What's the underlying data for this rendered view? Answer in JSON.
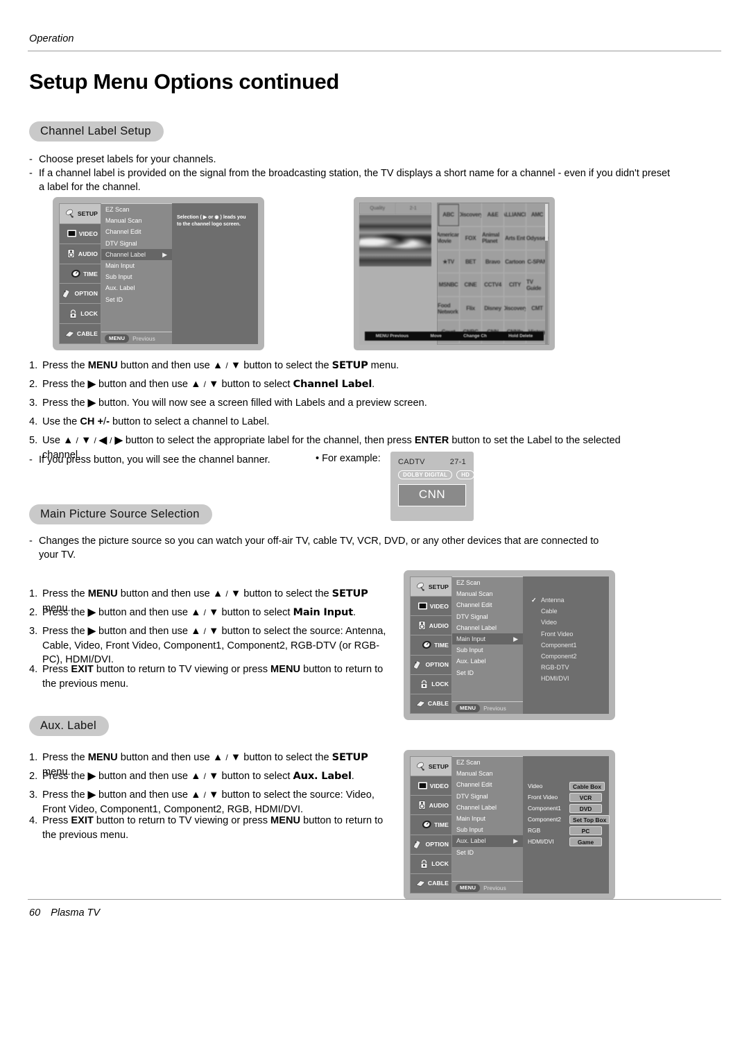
{
  "header": {
    "running_head": "Operation",
    "title": "Setup Menu Options continued"
  },
  "footer": {
    "page_number": "60",
    "product": "Plasma TV"
  },
  "sections": [
    {
      "id": "channel-label-setup",
      "heading": "Channel Label Setup",
      "bullets": [
        "Choose preset labels for your channels.",
        "If a channel label is provided on the signal from the broadcasting station, the TV displays a short name for a channel - even if you didn't preset a label for the channel."
      ],
      "steps": [
        {
          "num": "1.",
          "text": "Press the MENU button and then use ▲ / ▼ button to select the SETUP menu."
        },
        {
          "num": "2.",
          "text": "Press the ▶ button and then use ▲ / ▼ button to select Channel Label."
        },
        {
          "num": "3.",
          "text": "Press the ▶ button. You will now see a screen filled with Labels and a preview screen."
        },
        {
          "num": "4.",
          "text": "Use the CH +/- button to select a channel to Label."
        },
        {
          "num": "5.",
          "text": "Use ▲ / ▼ / ◀ / ▶ button to select the appropriate label for the channel, then press ENTER button to set the Label to the selected channel."
        }
      ],
      "note": "If you press          button, you will see the channel banner.",
      "example_label": "• For example:"
    },
    {
      "id": "main-picture-source-selection",
      "heading": "Main Picture Source Selection",
      "bullets": [
        "Changes the picture source so you can watch your off-air TV, cable TV, VCR, DVD, or any other devices that are connected to your TV."
      ],
      "steps": [
        {
          "num": "1.",
          "text": "Press the MENU button and then use ▲ / ▼ button to select the SETUP menu."
        },
        {
          "num": "2.",
          "text": "Press the ▶ button and then use ▲ / ▼ button to select Main Input."
        },
        {
          "num": "3.",
          "text": "Press the ▶ button and then use ▲ / ▼ button to select the source: Antenna, Cable, Video, Front Video, Component1, Component2, RGB-DTV (or RGB-PC), HDMI/DVI."
        },
        {
          "num": "4.",
          "text": "Press EXIT button to return to TV viewing or press MENU button to return to the previous menu."
        }
      ]
    },
    {
      "id": "aux-label",
      "heading": "Aux. Label",
      "steps": [
        {
          "num": "1.",
          "text": "Press the MENU button and then use ▲ / ▼ button to select the SETUP menu."
        },
        {
          "num": "2.",
          "text": "Press the ▶ button and then use ▲ / ▼ button to select Aux. Label."
        },
        {
          "num": "3.",
          "text": "Press the ▶ button and then use ▲ / ▼ button to select the source: Video, Front Video, Component1, Component2, RGB, HDMI/DVI."
        },
        {
          "num": "4.",
          "text": "Press EXIT button to return to TV viewing or press MENU button to return to the previous menu."
        }
      ]
    }
  ],
  "osd_sidebar": [
    {
      "label": "SETUP",
      "icon": "satellite-dish-icon",
      "active": true
    },
    {
      "label": "VIDEO",
      "icon": "tv-screen-icon",
      "active": false
    },
    {
      "label": "AUDIO",
      "icon": "speaker-icon",
      "active": false
    },
    {
      "label": "TIME",
      "icon": "clock-icon",
      "active": false
    },
    {
      "label": "OPTION",
      "icon": "remote-control-icon",
      "active": false
    },
    {
      "label": "LOCK",
      "icon": "padlock-icon",
      "active": false
    },
    {
      "label": "CABLE",
      "icon": "cable-card-icon",
      "active": false
    }
  ],
  "osd_menu_items": [
    "EZ Scan",
    "Manual  Scan",
    "Channel Edit",
    "DTV Signal",
    "Channel Label",
    "Main Input",
    "Sub Input",
    "Aux. Label",
    "Set ID"
  ],
  "osd_menu_bar": {
    "button": "MENU",
    "text": "Previous"
  },
  "osd_caret": "▶",
  "osd_1": {
    "selected_item": "Channel Label",
    "help_text": "Selection ( ▶ or ◉ ) leads you to the channel logo screen."
  },
  "osd_2": {
    "selected_item": "Main Input",
    "sources": [
      {
        "label": "Antenna",
        "checked": true
      },
      {
        "label": "Cable",
        "checked": false
      },
      {
        "label": "Video",
        "checked": false
      },
      {
        "label": "Front Video",
        "checked": false
      },
      {
        "label": "Component1",
        "checked": false
      },
      {
        "label": "Component2",
        "checked": false
      },
      {
        "label": "RGB-DTV",
        "checked": false
      },
      {
        "label": "HDMI/DVI",
        "checked": false
      }
    ],
    "check_glyph": "✓"
  },
  "osd_3": {
    "selected_item": "Aux. Label",
    "assignments": [
      {
        "input": "Video",
        "value": "Cable Box"
      },
      {
        "input": "Front Video",
        "value": "VCR"
      },
      {
        "input": "Component1",
        "value": "DVD"
      },
      {
        "input": "Component2",
        "value": "Set Top Box"
      },
      {
        "input": "RGB",
        "value": "PC"
      },
      {
        "input": "HDMI/DVI",
        "value": "Game"
      }
    ]
  },
  "logo_screen": {
    "preview_channel_name": "Quality",
    "preview_channel_number": "2-1",
    "selected_cell_index": 1,
    "logos": [
      "ABC",
      "Discovery",
      "A&E",
      "ALLIANCE",
      "AMC",
      "American\nMovie",
      "FOX",
      "Animal\nPlanet",
      "Arts\nEnt",
      "Odyssey",
      "★TV",
      "BET",
      "Bravo",
      "Cartoon",
      "C-SPAN",
      "MSNBC",
      "CINE",
      "CCTV4",
      "CITY",
      "TV Guide",
      "Food\nNetwork",
      "Flix",
      "Disney",
      "Discovery",
      "CMT",
      "Court",
      "CNBC",
      "CNN",
      "CNNfn",
      "History"
    ],
    "bottom_bar": [
      "MENU Previous",
      "Move",
      "Change Ch",
      "Hold Delete"
    ]
  },
  "channel_banner": {
    "source": "CADTV",
    "channel": "27-1",
    "tags": [
      "DOLBY DIGITAL",
      "HD"
    ],
    "name": "CNN"
  }
}
